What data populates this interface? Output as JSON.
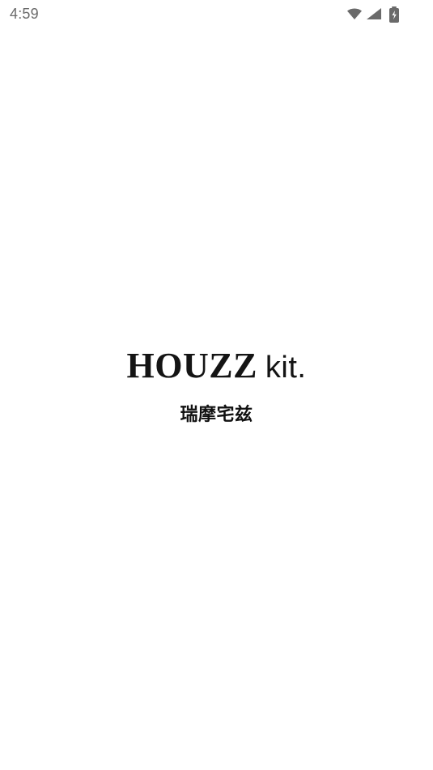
{
  "status_bar": {
    "time": "4:59",
    "icons": [
      "wifi-icon",
      "cellular-signal-icon",
      "battery-charging-icon"
    ],
    "icon_color": "#6a6a6a"
  },
  "splash": {
    "brand_main": "HOUZZ",
    "brand_sub": "kit.",
    "tagline": "瑞摩宅兹",
    "text_color": "#141414",
    "background": "#ffffff"
  }
}
